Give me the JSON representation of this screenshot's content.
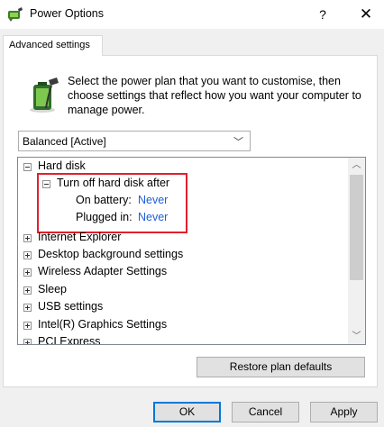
{
  "window": {
    "title": "Power Options",
    "help_label": "?",
    "close_label": "✕"
  },
  "tab": {
    "label": "Advanced settings"
  },
  "description": "Select the power plan that you want to customise, then choose settings that reflect how you want your computer to manage power.",
  "plan": {
    "selected": "Balanced [Active]"
  },
  "tree": {
    "hard_disk": "Hard disk",
    "turn_off": "Turn off hard disk after",
    "on_battery_label": "On battery:",
    "on_battery_value": "Never",
    "plugged_in_label": "Plugged in:",
    "plugged_in_value": "Never",
    "items": [
      "Internet Explorer",
      "Desktop background settings",
      "Wireless Adapter Settings",
      "Sleep",
      "USB settings",
      "Intel(R) Graphics Settings",
      "PCI Express"
    ]
  },
  "buttons": {
    "restore": "Restore plan defaults",
    "ok": "OK",
    "cancel": "Cancel",
    "apply": "Apply"
  },
  "icons": {
    "app": "power-options-icon",
    "battery": "battery-plug-icon"
  },
  "colors": {
    "link": "#1e5fd6",
    "highlight": "#e0202c",
    "default_button_border": "#0078d7"
  }
}
